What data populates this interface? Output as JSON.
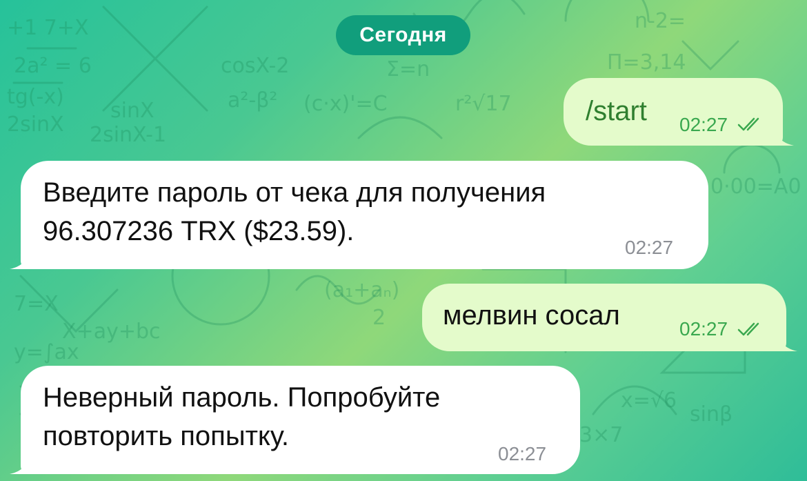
{
  "date_separator": "Сегодня",
  "colors": {
    "incoming_bubble": "#ffffff",
    "outgoing_bubble": "#e4fbcb",
    "date_pill": "#119e7c",
    "outgoing_time": "#3aa84f",
    "incoming_time": "#8c8f95"
  },
  "messages": [
    {
      "direction": "outgoing",
      "text": "/start",
      "time": "02:27",
      "status_icon": "double-check-read-icon"
    },
    {
      "direction": "incoming",
      "text": "Введите пароль от чека для получения\n96.307236 TRX ($23.59).",
      "time": "02:27"
    },
    {
      "direction": "outgoing",
      "text": "мелвин сосал",
      "time": "02:27",
      "status_icon": "double-check-read-icon"
    },
    {
      "direction": "incoming",
      "text": "Неверный пароль. Попробуйте\nповторить попытку.",
      "time": "02:27"
    }
  ]
}
